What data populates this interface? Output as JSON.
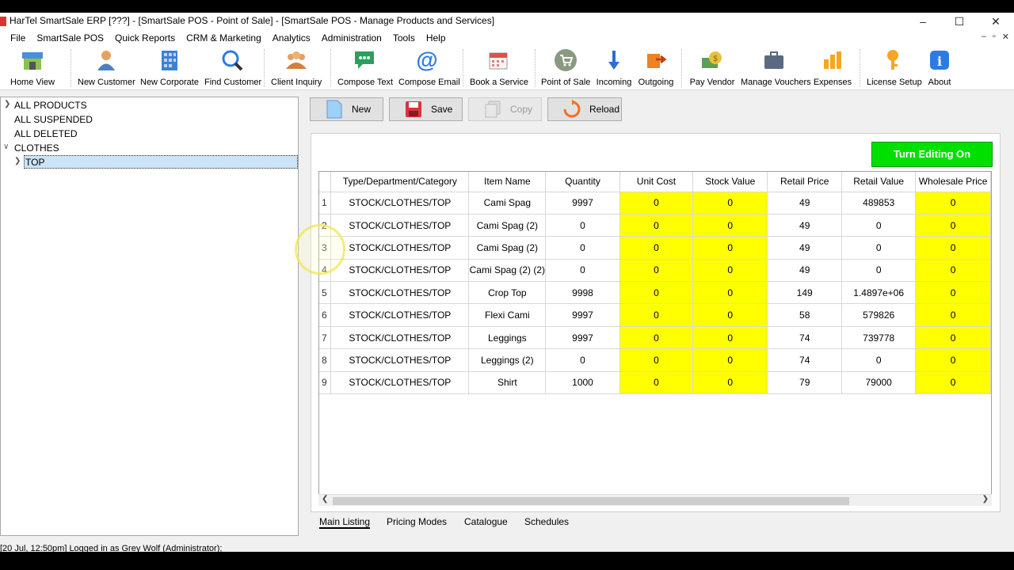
{
  "window": {
    "title": "HarTel SmartSale ERP [???] - [SmartSale POS - Point of Sale] - [SmartSale POS - Manage Products and Services]",
    "controls": [
      "–",
      "☐",
      "✕"
    ],
    "mdi_controls": [
      "–",
      "▫",
      "✕"
    ]
  },
  "menu": [
    "File",
    "SmartSale POS",
    "Quick Reports",
    "CRM & Marketing",
    "Analytics",
    "Administration",
    "Tools",
    "Help"
  ],
  "toolbar": {
    "home_view": "Home View",
    "new_customer": "New Customer",
    "new_corporate": "New Corporate",
    "find_customer": "Find Customer",
    "client_inquiry": "Client Inquiry",
    "compose_text": "Compose Text",
    "compose_email": "Compose Email",
    "book_service": "Book a Service",
    "point_of_sale": "Point of Sale",
    "incoming": "Incoming",
    "outgoing": "Outgoing",
    "pay_vendor": "Pay Vendor",
    "manage_vouchers": "Manage Vouchers",
    "expenses": "Expenses",
    "license_setup": "License Setup",
    "about": "About"
  },
  "tree": {
    "all_products": "ALL PRODUCTS",
    "all_suspended": "ALL SUSPENDED",
    "all_deleted": "ALL DELETED",
    "clothes": "CLOTHES",
    "top": "TOP"
  },
  "actions": {
    "new": "New",
    "save": "Save",
    "copy": "Copy",
    "reload": "Reload",
    "turn_editing_on": "Turn Editing On"
  },
  "colors": {
    "editing_button": "#00e000",
    "highlight_cells": "#ffff00"
  },
  "grid": {
    "columns": [
      "Type/Department/Category",
      "Item Name",
      "Quantity",
      "Unit Cost",
      "Stock Value",
      "Retail Price",
      "Retail Value",
      "Wholesale Price"
    ],
    "rows": [
      {
        "n": "1",
        "type": "STOCK/CLOTHES/TOP",
        "item": "Cami Spag",
        "qty": "9997",
        "unit_cost": "0",
        "stock_value": "0",
        "retail_price": "49",
        "retail_value": "489853",
        "wholesale": "0"
      },
      {
        "n": "2",
        "type": "STOCK/CLOTHES/TOP",
        "item": "Cami Spag (2)",
        "qty": "0",
        "unit_cost": "0",
        "stock_value": "0",
        "retail_price": "49",
        "retail_value": "0",
        "wholesale": "0"
      },
      {
        "n": "3",
        "type": "STOCK/CLOTHES/TOP",
        "item": "Cami Spag (2)",
        "qty": "0",
        "unit_cost": "0",
        "stock_value": "0",
        "retail_price": "49",
        "retail_value": "0",
        "wholesale": "0"
      },
      {
        "n": "4",
        "type": "STOCK/CLOTHES/TOP",
        "item": "Cami Spag (2) (2)",
        "qty": "0",
        "unit_cost": "0",
        "stock_value": "0",
        "retail_price": "49",
        "retail_value": "0",
        "wholesale": "0"
      },
      {
        "n": "5",
        "type": "STOCK/CLOTHES/TOP",
        "item": "Crop Top",
        "qty": "9998",
        "unit_cost": "0",
        "stock_value": "0",
        "retail_price": "149",
        "retail_value": "1.4897e+06",
        "wholesale": "0"
      },
      {
        "n": "6",
        "type": "STOCK/CLOTHES/TOP",
        "item": "Flexi Cami",
        "qty": "9997",
        "unit_cost": "0",
        "stock_value": "0",
        "retail_price": "58",
        "retail_value": "579826",
        "wholesale": "0"
      },
      {
        "n": "7",
        "type": "STOCK/CLOTHES/TOP",
        "item": "Leggings",
        "qty": "9997",
        "unit_cost": "0",
        "stock_value": "0",
        "retail_price": "74",
        "retail_value": "739778",
        "wholesale": "0"
      },
      {
        "n": "8",
        "type": "STOCK/CLOTHES/TOP",
        "item": "Leggings (2)",
        "qty": "0",
        "unit_cost": "0",
        "stock_value": "0",
        "retail_price": "74",
        "retail_value": "0",
        "wholesale": "0"
      },
      {
        "n": "9",
        "type": "STOCK/CLOTHES/TOP",
        "item": "Shirt",
        "qty": "1000",
        "unit_cost": "0",
        "stock_value": "0",
        "retail_price": "79",
        "retail_value": "79000",
        "wholesale": "0"
      }
    ]
  },
  "tabs": [
    "Main Listing",
    "Pricing Modes",
    "Catalogue",
    "Schedules"
  ],
  "status": "[20 Jul, 12:50pm] Logged in as Grey Wolf (Administrator);"
}
